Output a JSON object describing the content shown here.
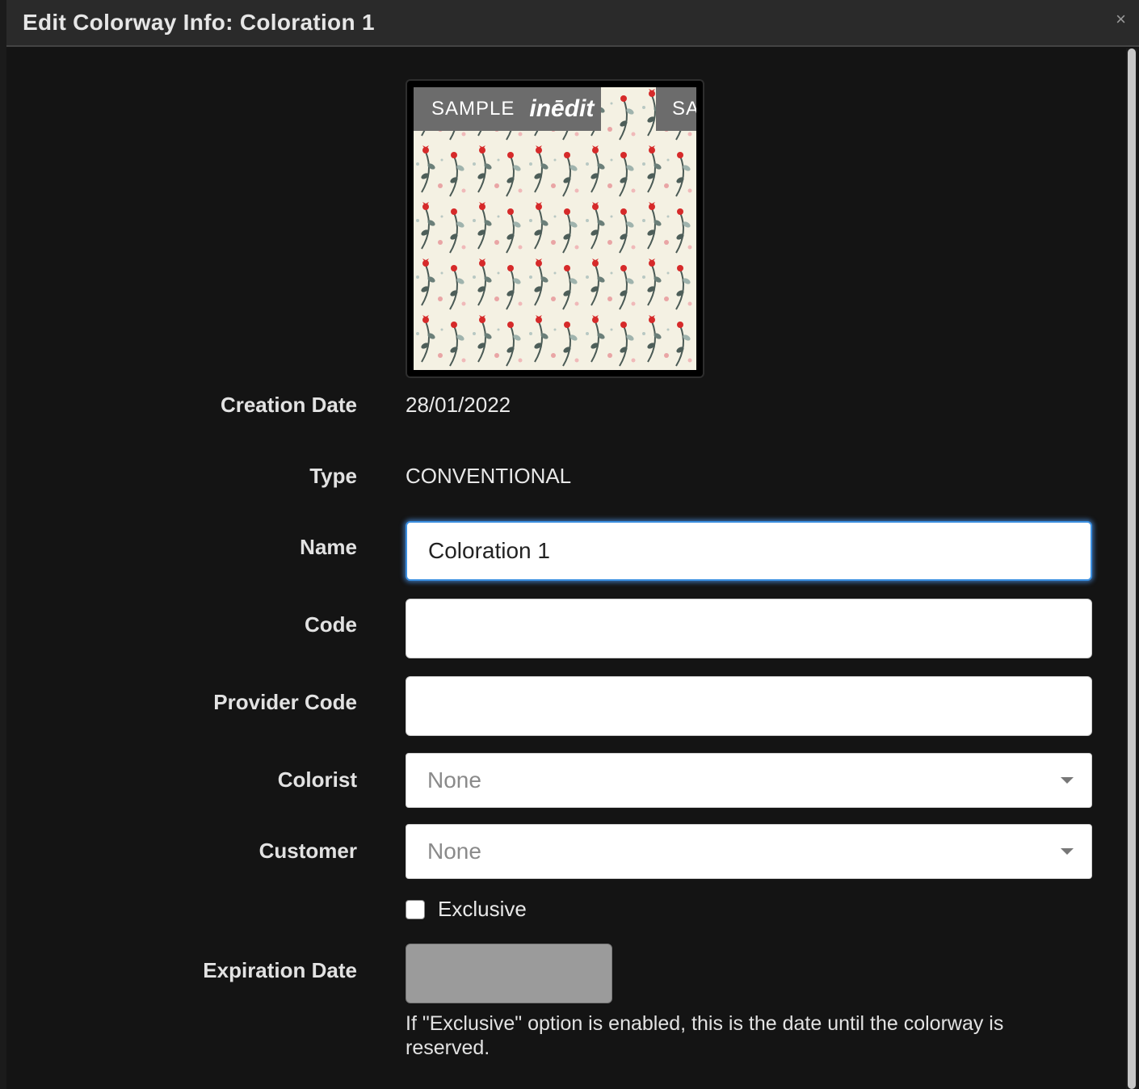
{
  "modal": {
    "title": "Edit Colorway Info: Coloration 1",
    "close_icon": "×"
  },
  "thumbnail": {
    "sample_text": "SAMPLE",
    "brand_text": "inēdit",
    "sample_text_partial": "SA",
    "background_color": "#f4f1e3",
    "pattern": "floral-red-green"
  },
  "fields": {
    "creation_date": {
      "label": "Creation Date",
      "value": "28/01/2022"
    },
    "type": {
      "label": "Type",
      "value": "CONVENTIONAL"
    },
    "name": {
      "label": "Name",
      "value": "Coloration 1",
      "placeholder": ""
    },
    "code": {
      "label": "Code",
      "value": "",
      "placeholder": ""
    },
    "provider_code": {
      "label": "Provider Code",
      "value": "",
      "placeholder": ""
    },
    "colorist": {
      "label": "Colorist",
      "selected": "None"
    },
    "customer": {
      "label": "Customer",
      "selected": "None"
    },
    "exclusive": {
      "label": "Exclusive",
      "checked": false
    },
    "expiration_date": {
      "label": "Expiration Date",
      "help": "If \"Exclusive\" option is enabled, this is the date until the colorway is reserved."
    }
  },
  "colors": {
    "accent_focus": "#3b8fe0",
    "disabled_field": "#9b9b9b",
    "modal_bg": "#141414"
  }
}
